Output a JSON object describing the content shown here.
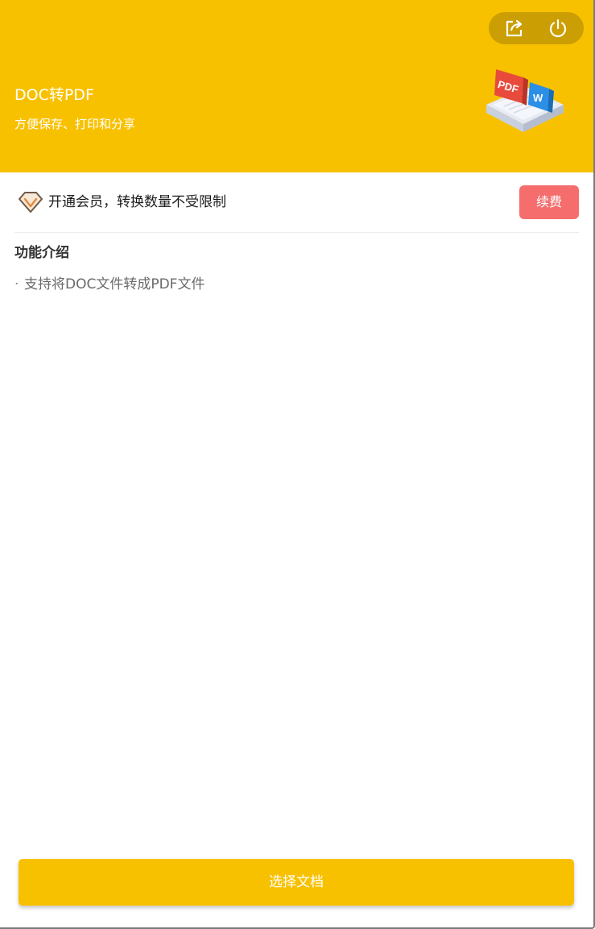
{
  "header": {
    "title": "DOC转PDF",
    "subtitle": "方便保存、打印和分享",
    "background_color": "#f8c100",
    "actions": {
      "share_icon": "share-icon",
      "power_icon": "power-icon"
    },
    "illustration": {
      "pdf_label": "PDF",
      "word_label": "W"
    }
  },
  "membership": {
    "icon": "vip-diamond-icon",
    "text": "开通会员，转换数量不受限制",
    "renew_label": "续费",
    "renew_color": "#f56d6d"
  },
  "features": {
    "title": "功能介绍",
    "items": [
      {
        "bullet": "·",
        "text": "支持将DOC文件转成PDF文件"
      }
    ]
  },
  "footer": {
    "select_label": "选择文档"
  }
}
